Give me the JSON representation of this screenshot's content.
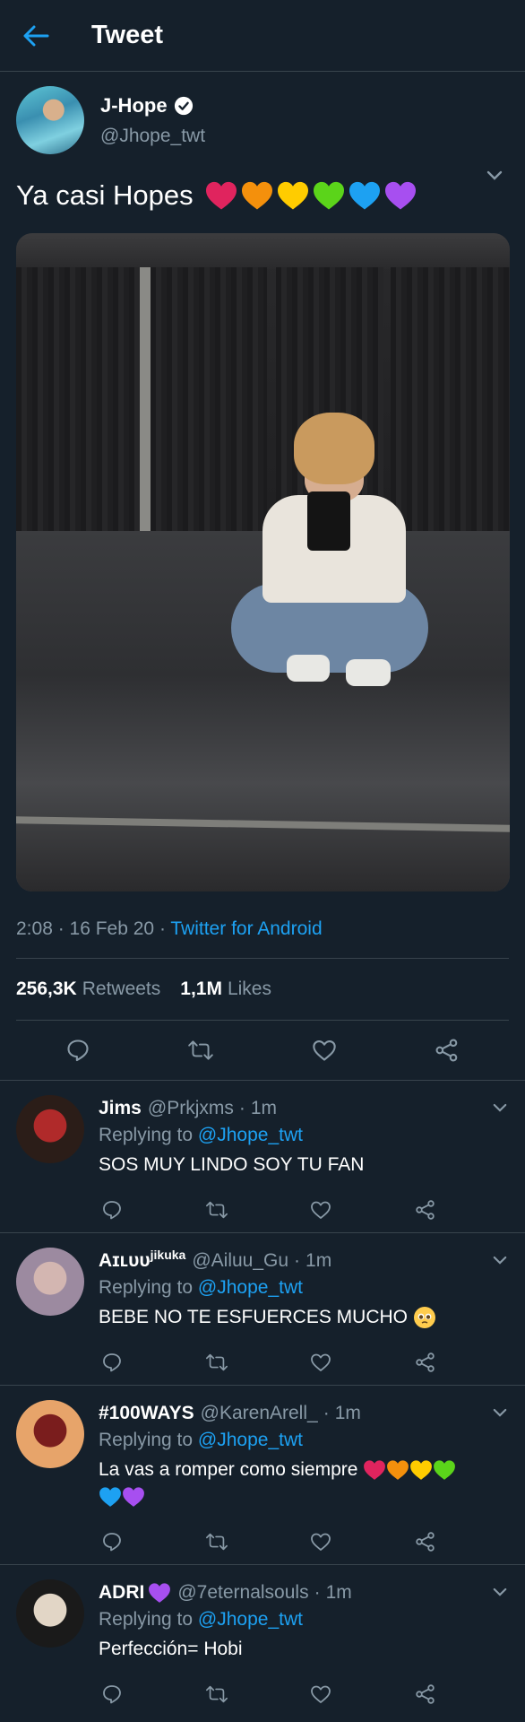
{
  "header": {
    "title": "Tweet",
    "back_icon": "arrow-left-icon",
    "accent": "#1da1f2"
  },
  "tweet": {
    "author_name": "J-Hope",
    "author_handle": "@Jhope_twt",
    "verified": true,
    "text": "Ya casi Hopes",
    "hearts": [
      "#e0245e",
      "#f4900c",
      "#ffcc00",
      "#5bd41a",
      "#1da1f2",
      "#a74ff0"
    ],
    "timestamp": "2:08 · 16 Feb 20 · ",
    "source": "Twitter for Android",
    "retweets_count": "256,3K",
    "retweets_label": "Retweets",
    "likes_count": "1,1M",
    "likes_label": "Likes"
  },
  "replies": [
    {
      "name": "Jims",
      "name_sup": "",
      "handle": "@Prkjxms",
      "time": "1m",
      "replying_prefix": "Replying to ",
      "mention": "@Jhope_twt",
      "text": "SOS MUY LINDO SOY TU FAN",
      "avatar_colors": [
        "#2b1d18",
        "#b02a2a"
      ]
    },
    {
      "name": "Aɪʟᴜᴜ",
      "name_sup": "jikuka",
      "handle": "@Ailuu_Gu",
      "time": "1m",
      "replying_prefix": "Replying to ",
      "mention": "@Jhope_twt",
      "text": "BEBE NO TE ESFUERCES MUCHO",
      "avatar_colors": [
        "#9c8aa0",
        "#d3b6b1"
      ]
    },
    {
      "name": "#100WAYS",
      "name_sup": "",
      "handle": "@KarenArell_",
      "time": "1m",
      "replying_prefix": "Replying to ",
      "mention": "@Jhope_twt",
      "text": "La vas a romper como siempre",
      "avatar_colors": [
        "#e7a46a",
        "#7a1d1d"
      ]
    },
    {
      "name": "ADRI",
      "name_sup": "",
      "handle": "@7eternalsouls",
      "time": "1m",
      "replying_prefix": "Replying to ",
      "mention": "@Jhope_twt",
      "text": "Perfección= Hobi",
      "avatar_colors": [
        "#1a1a1a",
        "#e2d6c6"
      ]
    }
  ]
}
